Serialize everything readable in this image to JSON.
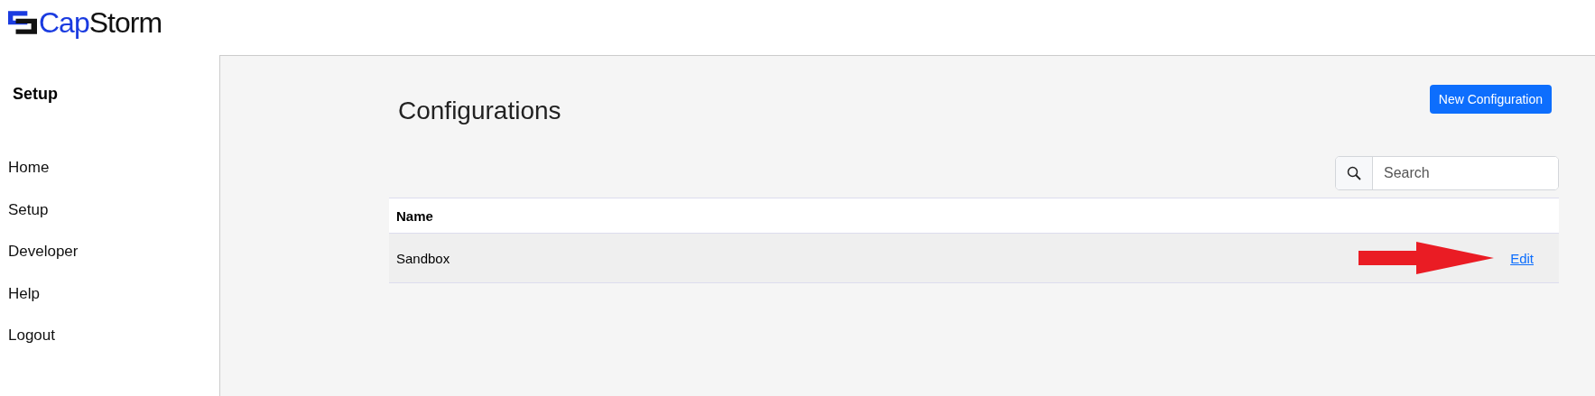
{
  "logo": {
    "first": "Cap",
    "second": "Storm"
  },
  "sidebar": {
    "title": "Setup",
    "items": [
      "Home",
      "Setup",
      "Developer",
      "Help",
      "Logout"
    ]
  },
  "page": {
    "title": "Configurations",
    "new_button": "New Configuration",
    "search": {
      "placeholder": "Search"
    }
  },
  "table": {
    "columns": [
      "Name"
    ],
    "rows": [
      {
        "name": "Sandbox",
        "action": "Edit"
      }
    ]
  }
}
